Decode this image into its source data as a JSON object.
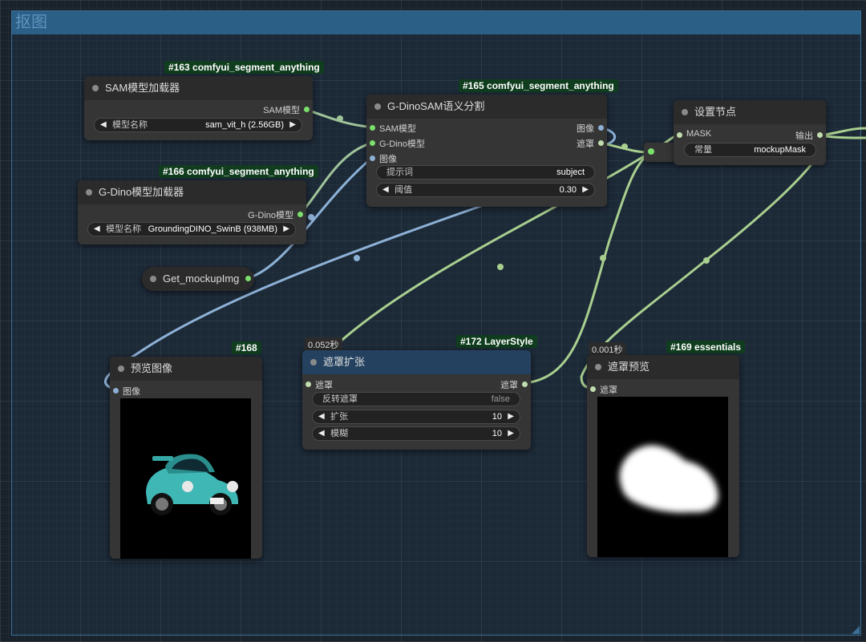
{
  "group": {
    "title": "抠图"
  },
  "nodes": {
    "sam_loader": {
      "badge": "#163 comfyui_segment_anything",
      "title": "SAM模型加载器",
      "output": "SAM模型",
      "widget": {
        "label": "模型名称",
        "value": "sam_vit_h (2.56GB)"
      }
    },
    "dino_loader": {
      "badge": "#166 comfyui_segment_anything",
      "title": "G-Dino模型加载器",
      "output": "G-Dino模型",
      "widget": {
        "label": "模型名称",
        "value": "GroundingDINO_SwinB (938MB)"
      }
    },
    "get_mockup": {
      "title": "Get_mockupImg"
    },
    "dino_sam": {
      "badge": "#165 comfyui_segment_anything",
      "title": "G-DinoSAM语义分割",
      "inputs": [
        "SAM模型",
        "G-Dino模型",
        "图像"
      ],
      "outputs": [
        "图像",
        "遮罩"
      ],
      "prompt": {
        "label": "提示词",
        "value": "subject"
      },
      "threshold": {
        "label": "阈值",
        "value": "0.30"
      }
    },
    "set_node": {
      "title": "设置节点",
      "input": "MASK",
      "output": "输出",
      "widget": {
        "label": "常量",
        "value": "mockupMask"
      }
    },
    "preview_image": {
      "badge": "#168",
      "title": "预览图像",
      "input": "图像"
    },
    "mask_grow": {
      "badge": "#172 LayerStyle",
      "timing": "0.052秒",
      "title": "遮罩扩张",
      "input": "遮罩",
      "output": "遮罩",
      "invert": {
        "label": "反转遮罩",
        "value": "false"
      },
      "grow": {
        "label": "扩张",
        "value": "10"
      },
      "blur": {
        "label": "模糊",
        "value": "10"
      }
    },
    "mask_preview": {
      "badge": "#169 essentials",
      "timing": "0.001秒",
      "title": "遮罩预览",
      "input": "遮罩"
    }
  },
  "colors": {
    "image_wire": "#8db1d6",
    "mask_wire": "#a9cf8f",
    "model_wire": "#9fc49a",
    "badge_bg": "#0f3d1d",
    "group_header": "#2c5f86"
  }
}
